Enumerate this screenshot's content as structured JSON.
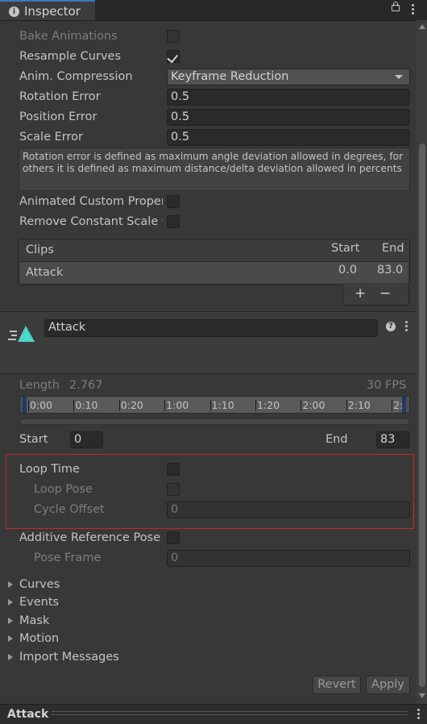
{
  "window": {
    "tab_title": "Inspector",
    "bottom_title": "Attack"
  },
  "settings": {
    "bake_animations_label": "Bake Animations",
    "bake_animations_checked": false,
    "resample_curves_label": "Resample Curves",
    "resample_curves_checked": true,
    "anim_compression_label": "Anim. Compression",
    "anim_compression_value": "Keyframe Reduction",
    "rotation_error_label": "Rotation Error",
    "rotation_error_value": "0.5",
    "position_error_label": "Position Error",
    "position_error_value": "0.5",
    "scale_error_label": "Scale Error",
    "scale_error_value": "0.5",
    "help_text": "Rotation error is defined as maximum angle deviation allowed in degrees, for others it is defined as maximum distance/delta deviation allowed in percents",
    "animated_custom_label": "Animated Custom Proper",
    "remove_constant_label": "Remove Constant Scale C"
  },
  "clips": {
    "header_clips": "Clips",
    "header_start": "Start",
    "header_end": "End",
    "rows": [
      {
        "name": "Attack",
        "start": "0.0",
        "end": "83.0"
      }
    ],
    "add_label": "+",
    "remove_label": "−"
  },
  "clip": {
    "name_value": "Attack",
    "length_label": "Length",
    "length_value": "2.767",
    "fps_label": "30 FPS",
    "timeline_ticks": [
      "0:00",
      "0:10",
      "0:20",
      "1:00",
      "1:10",
      "1:20",
      "2:00",
      "2:10",
      "2:"
    ],
    "start_label": "Start",
    "start_value": "0",
    "end_label": "End",
    "end_value": "83"
  },
  "loop": {
    "loop_time_label": "Loop Time",
    "loop_time_checked": false,
    "loop_pose_label": "Loop Pose",
    "cycle_offset_label": "Cycle Offset",
    "cycle_offset_value": "0"
  },
  "additive": {
    "label": "Additive Reference Pose",
    "pose_frame_label": "Pose Frame",
    "pose_frame_value": "0"
  },
  "foldouts": [
    "Curves",
    "Events",
    "Mask",
    "Motion",
    "Import Messages"
  ],
  "buttons": {
    "revert": "Revert",
    "apply": "Apply"
  },
  "colors": {
    "highlight": "#c42828",
    "accent": "#3a79bb",
    "icon_cyan": "#4fd6c8"
  }
}
